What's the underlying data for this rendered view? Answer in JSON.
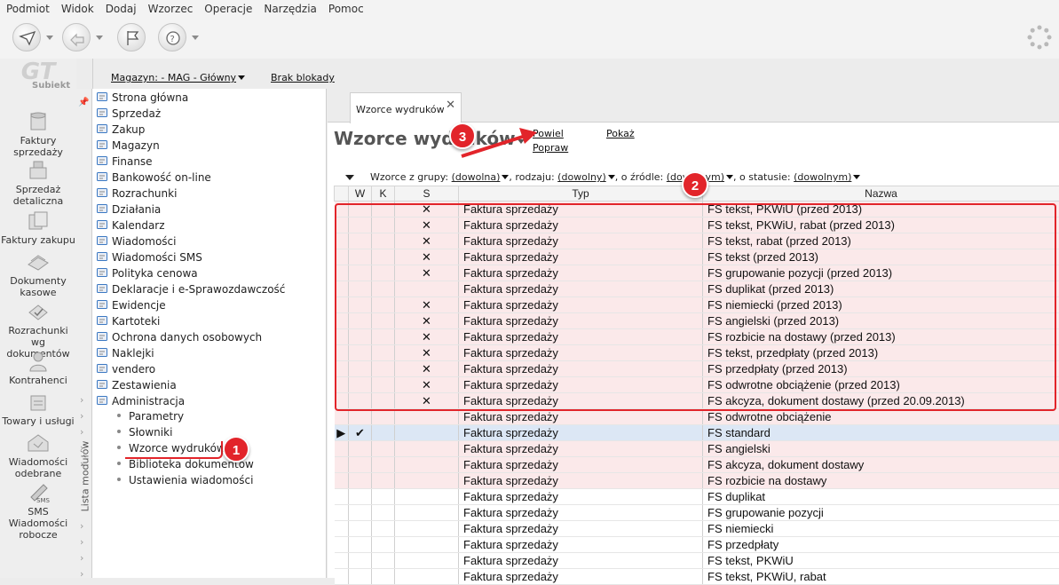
{
  "menu": [
    "Podmiot",
    "Widok",
    "Dodaj",
    "Wzorzec",
    "Operacje",
    "Narzędzia",
    "Pomoc"
  ],
  "logo": {
    "mark": "GT",
    "name": "Subiekt"
  },
  "modules": [
    {
      "label": "Faktury sprzedaży",
      "icon": "invoice-stack-icon"
    },
    {
      "label": "Sprzedaż detaliczna",
      "icon": "cash-register-icon"
    },
    {
      "label": "Faktury zakupu",
      "icon": "purchase-invoice-icon"
    },
    {
      "label": "Dokumenty kasowe",
      "icon": "cash-documents-icon"
    },
    {
      "label": "Rozrachunki wg dokumentów",
      "icon": "settlements-icon"
    },
    {
      "label": "Kontrahenci",
      "icon": "contractors-icon"
    },
    {
      "label": "Towary i usługi",
      "icon": "goods-icon"
    },
    {
      "label": "Wiadomości odebrane",
      "icon": "inbox-icon"
    },
    {
      "label": "SMS Wiadomości robocze",
      "icon": "sms-icon"
    }
  ],
  "lista_modulow": "Lista modułów",
  "header": {
    "magazyn": "Magazyn: - MAG - Główny",
    "blokada": "Brak blokady"
  },
  "tree": {
    "items": [
      "Strona główna",
      "Sprzedaż",
      "Zakup",
      "Magazyn",
      "Finanse",
      "Bankowość on-line",
      "Rozrachunki",
      "Działania",
      "Kalendarz",
      "Wiadomości",
      "Wiadomości SMS",
      "Polityka cenowa",
      "Deklaracje i e-Sprawozdawczość",
      "Ewidencje",
      "Kartoteki",
      "Ochrona danych osobowych",
      "Naklejki",
      "vendero",
      "Zestawienia",
      "Administracja"
    ],
    "subitems": [
      "Parametry",
      "Słowniki",
      "Wzorce wydruków",
      "Biblioteka dokumentów",
      "Ustawienia wiadomości"
    ]
  },
  "tab": {
    "label": "Wzorce wydruków",
    "close": "✕"
  },
  "page_title": "Wzorce wydruków",
  "actions": {
    "powiel": "Powiel",
    "popraw": "Popraw",
    "pokaz": "Pokaż"
  },
  "filters": {
    "label_group": "Wzorce z grupy:",
    "group": "(dowolna)",
    "label_kind": ", rodzaju:",
    "kind": "(dowolny)",
    "label_source": ", o źródle:",
    "source": "(dowolnym)",
    "label_status": ", o statusie:",
    "status": "(dowolnym)"
  },
  "columns": [
    "W",
    "K",
    "S",
    "Typ",
    "Nazwa"
  ],
  "rows": [
    {
      "w": "",
      "s": "✕",
      "typ": "Faktura sprzedaży",
      "nazwa": "FS tekst, PKWiU (przed 2013)",
      "style": "pink"
    },
    {
      "w": "",
      "s": "✕",
      "typ": "Faktura sprzedaży",
      "nazwa": "FS tekst, PKWiU, rabat (przed 2013)",
      "style": "pink"
    },
    {
      "w": "",
      "s": "✕",
      "typ": "Faktura sprzedaży",
      "nazwa": "FS tekst, rabat (przed 2013)",
      "style": "pink"
    },
    {
      "w": "",
      "s": "✕",
      "typ": "Faktura sprzedaży",
      "nazwa": "FS tekst (przed 2013)",
      "style": "pink"
    },
    {
      "w": "",
      "s": "✕",
      "typ": "Faktura sprzedaży",
      "nazwa": "FS grupowanie pozycji (przed 2013)",
      "style": "pink"
    },
    {
      "w": "",
      "s": "",
      "typ": "Faktura sprzedaży",
      "nazwa": "FS duplikat (przed 2013)",
      "style": "pink"
    },
    {
      "w": "",
      "s": "✕",
      "typ": "Faktura sprzedaży",
      "nazwa": "FS niemiecki (przed 2013)",
      "style": "pink"
    },
    {
      "w": "",
      "s": "✕",
      "typ": "Faktura sprzedaży",
      "nazwa": "FS angielski (przed 2013)",
      "style": "pink"
    },
    {
      "w": "",
      "s": "✕",
      "typ": "Faktura sprzedaży",
      "nazwa": "FS rozbicie na dostawy (przed 2013)",
      "style": "pink"
    },
    {
      "w": "",
      "s": "✕",
      "typ": "Faktura sprzedaży",
      "nazwa": "FS tekst, przedpłaty (przed 2013)",
      "style": "pink"
    },
    {
      "w": "",
      "s": "✕",
      "typ": "Faktura sprzedaży",
      "nazwa": "FS przedpłaty (przed 2013)",
      "style": "pink"
    },
    {
      "w": "",
      "s": "✕",
      "typ": "Faktura sprzedaży",
      "nazwa": "FS odwrotne obciążenie (przed 2013)",
      "style": "pink"
    },
    {
      "w": "",
      "s": "✕",
      "typ": "Faktura sprzedaży",
      "nazwa": "FS akcyza, dokument dostawy (przed 20.09.2013)",
      "style": "pink"
    },
    {
      "w": "",
      "s": "",
      "typ": "Faktura sprzedaży",
      "nazwa": "FS odwrotne obciążenie",
      "style": "pink"
    },
    {
      "w": "✔",
      "s": "",
      "typ": "Faktura sprzedaży",
      "nazwa": "FS standard",
      "style": "sel"
    },
    {
      "w": "",
      "s": "",
      "typ": "Faktura sprzedaży",
      "nazwa": "FS angielski",
      "style": "pink"
    },
    {
      "w": "",
      "s": "",
      "typ": "Faktura sprzedaży",
      "nazwa": "FS akcyza, dokument dostawy",
      "style": "pink"
    },
    {
      "w": "",
      "s": "",
      "typ": "Faktura sprzedaży",
      "nazwa": "FS rozbicie na dostawy",
      "style": "pink"
    },
    {
      "w": "",
      "s": "",
      "typ": "Faktura sprzedaży",
      "nazwa": "FS duplikat",
      "style": "white"
    },
    {
      "w": "",
      "s": "",
      "typ": "Faktura sprzedaży",
      "nazwa": "FS grupowanie pozycji",
      "style": "white"
    },
    {
      "w": "",
      "s": "",
      "typ": "Faktura sprzedaży",
      "nazwa": "FS niemiecki",
      "style": "white"
    },
    {
      "w": "",
      "s": "",
      "typ": "Faktura sprzedaży",
      "nazwa": "FS przedpłaty",
      "style": "white"
    },
    {
      "w": "",
      "s": "",
      "typ": "Faktura sprzedaży",
      "nazwa": "FS tekst, PKWiU",
      "style": "white"
    },
    {
      "w": "",
      "s": "",
      "typ": "Faktura sprzedaży",
      "nazwa": "FS tekst, PKWiU, rabat",
      "style": "white"
    }
  ],
  "current_row_marker": "▶",
  "annotations": [
    "1",
    "2",
    "3"
  ],
  "colors": {
    "annotation": "#e2242a",
    "selected_row": "#dce7f5",
    "highlighted_rows": "#fbe9ea"
  }
}
